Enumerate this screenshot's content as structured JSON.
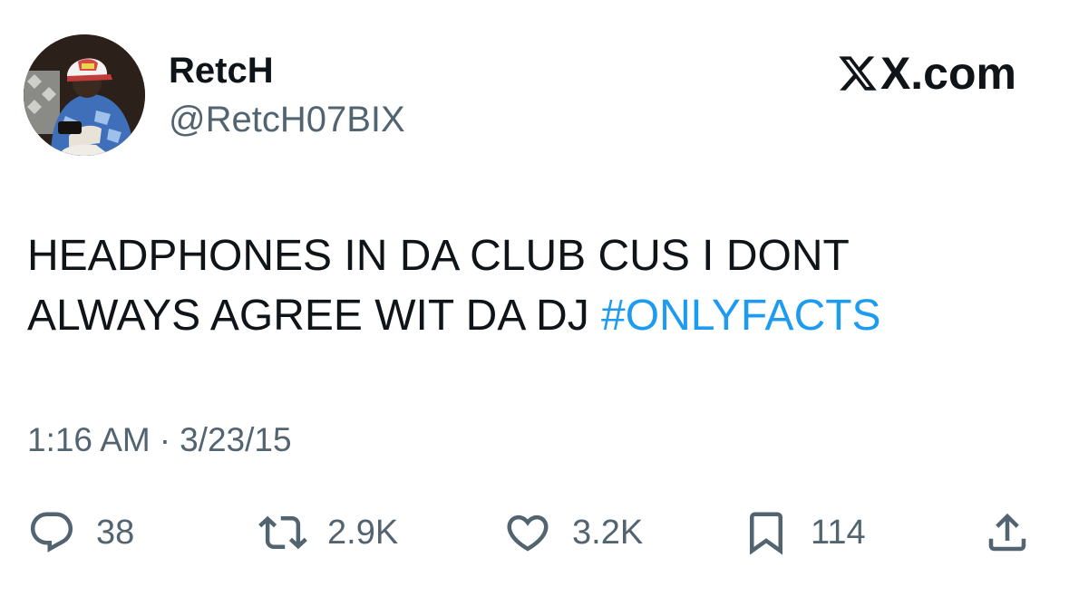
{
  "tweet": {
    "author": {
      "display_name": "RetcH",
      "handle": "@RetcH07BIX"
    },
    "brand": "X.com",
    "text_main": "HEADPHONES IN DA CLUB CUS I DONT ALWAYS AGREE WIT DA DJ ",
    "hashtag": "#ONLYFACTS",
    "time": "1:16 AM",
    "separator": "·",
    "date": "3/23/15",
    "metrics": {
      "replies": "38",
      "reposts": "2.9K",
      "likes": "3.2K",
      "bookmarks": "114"
    }
  },
  "icons": {
    "reply": "reply-icon",
    "repost": "repost-icon",
    "like": "heart-icon",
    "bookmark": "bookmark-icon",
    "share": "share-icon",
    "brand": "x-logo-icon"
  },
  "colors": {
    "text": "#0f1419",
    "secondary": "#536471",
    "link": "#1d9bf0",
    "background": "#ffffff"
  }
}
